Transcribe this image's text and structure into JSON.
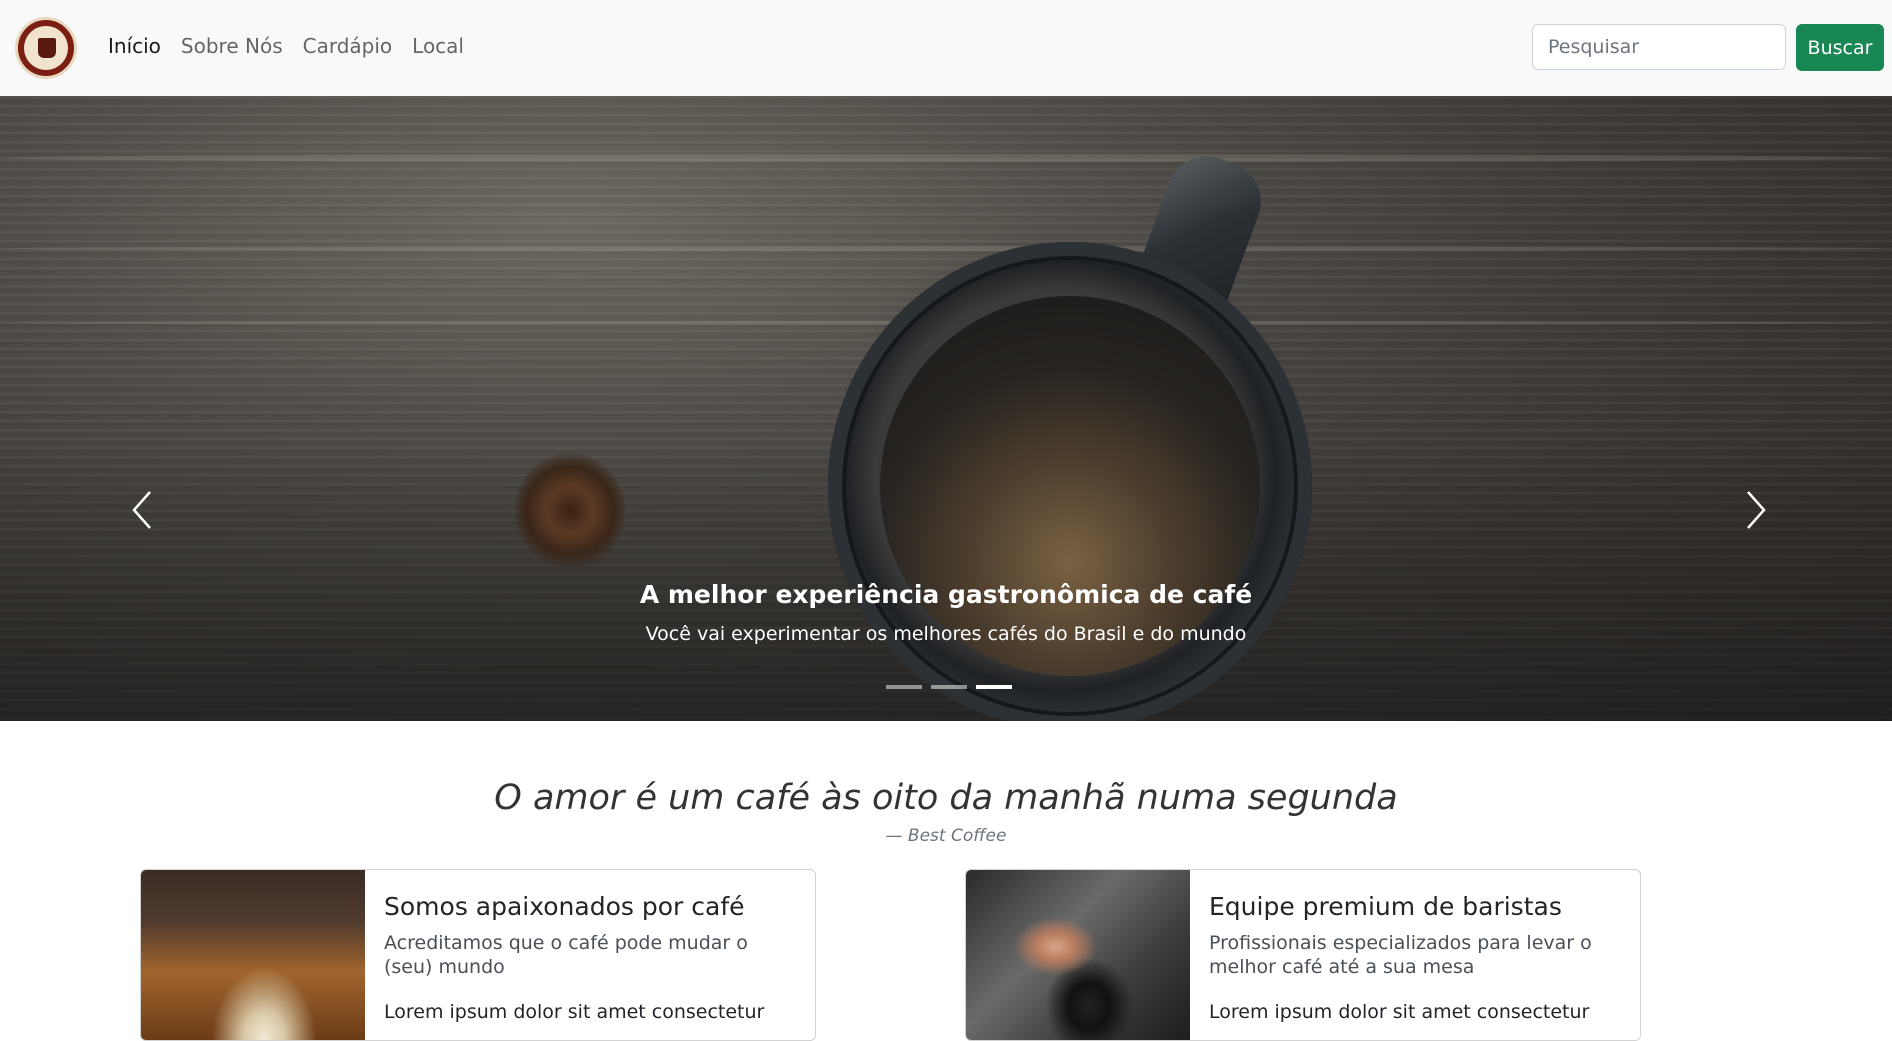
{
  "navbar": {
    "logo_alt": "Best Coffee",
    "links": [
      {
        "label": "Início",
        "active": true
      },
      {
        "label": "Sobre Nós",
        "active": false
      },
      {
        "label": "Cardápio",
        "active": false
      },
      {
        "label": "Local",
        "active": false
      }
    ],
    "search": {
      "placeholder": "Pesquisar",
      "value": ""
    },
    "search_button": "Buscar",
    "colors": {
      "background": "#f8f9fa",
      "button": "#198754"
    }
  },
  "carousel": {
    "caption_title": "A melhor experiência gastronômica de café",
    "caption_text": "Você vai experimentar os melhores cafés do Brasil e do mundo",
    "prev_icon": "chevron-left-icon",
    "next_icon": "chevron-right-icon",
    "indicators": 3,
    "active_indicator": 3
  },
  "quote": {
    "text": "O amor é um café às oito da manhã numa segunda",
    "footer": "— Best Coffee"
  },
  "cards": [
    {
      "title": "Somos apaixonados por café",
      "subtitle": "Acreditamos que o café pode mudar o (seu) mundo",
      "text": "Lorem ipsum dolor sit amet consectetur"
    },
    {
      "title": "Equipe premium de baristas",
      "subtitle": "Profissionais especializados para levar o melhor café até a sua mesa",
      "text": "Lorem ipsum dolor sit amet consectetur"
    }
  ]
}
